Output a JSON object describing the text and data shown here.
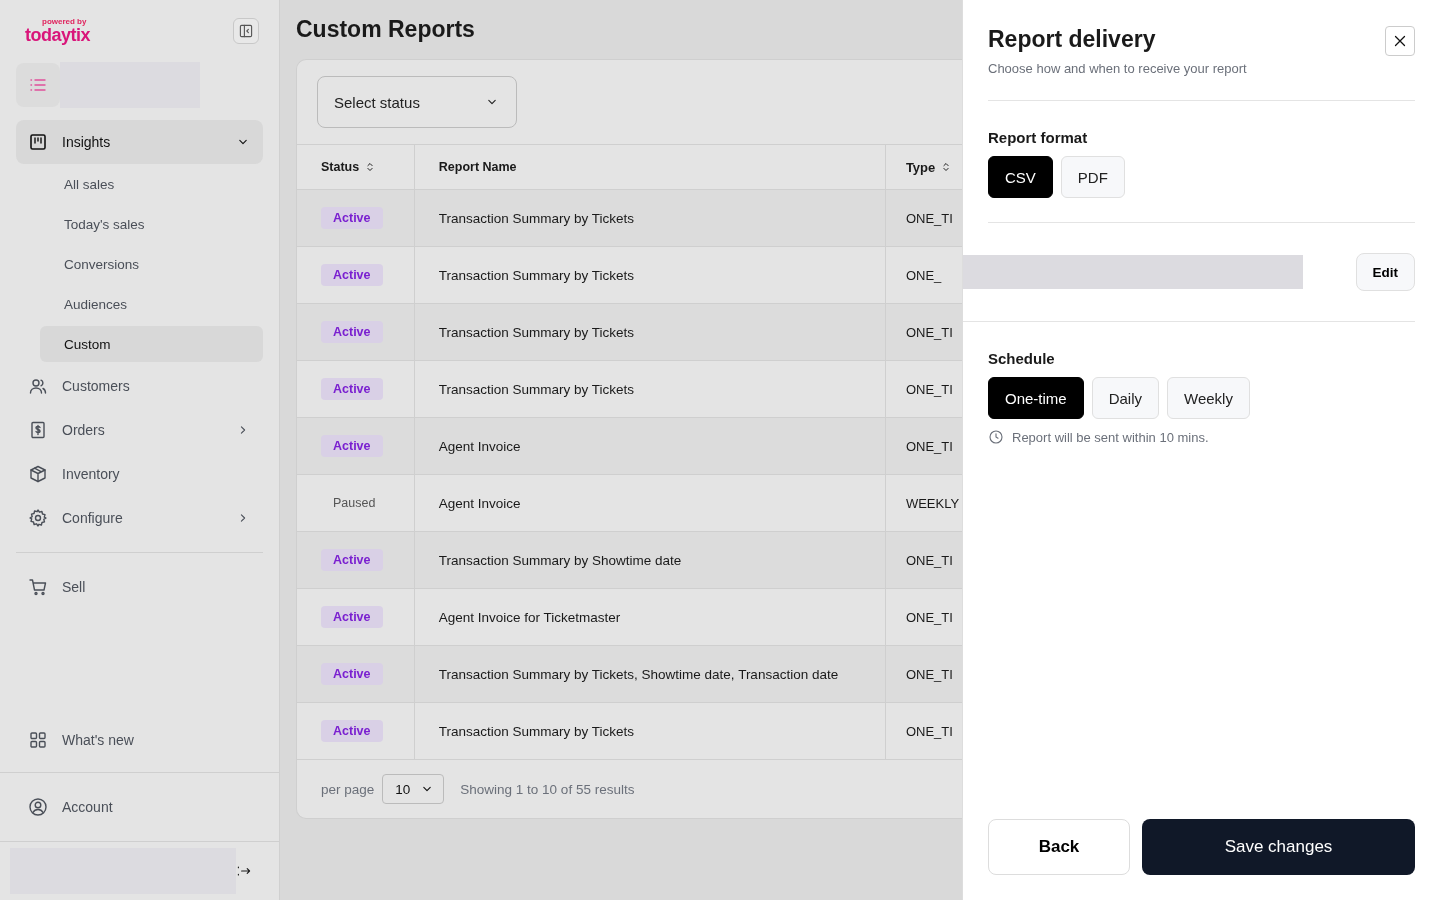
{
  "sidebar": {
    "logo": {
      "top": "powered by",
      "brand": "todaytix"
    },
    "nav": [
      {
        "label": "Insights",
        "selected": true,
        "expanded": true,
        "children": [
          {
            "label": "All sales",
            "selected": false
          },
          {
            "label": "Today's sales",
            "selected": false
          },
          {
            "label": "Conversions",
            "selected": false
          },
          {
            "label": "Audiences",
            "selected": false
          },
          {
            "label": "Custom",
            "selected": true
          }
        ]
      },
      {
        "label": "Customers",
        "selected": false
      },
      {
        "label": "Orders",
        "selected": false,
        "expanded": false
      },
      {
        "label": "Inventory",
        "selected": false
      },
      {
        "label": "Configure",
        "selected": false,
        "expanded": false
      }
    ],
    "sell": {
      "label": "Sell"
    },
    "whats_new": {
      "label": "What's new"
    },
    "account": {
      "label": "Account"
    }
  },
  "page": {
    "title": "Custom Reports",
    "filter": {
      "placeholder": "Select status"
    },
    "table": {
      "columns": [
        "Status",
        "Report Name",
        "Type"
      ],
      "rows": [
        {
          "status": "Active",
          "kind": "active",
          "name": "Transaction Summary by Tickets",
          "type": "ONE_TI"
        },
        {
          "status": "Active",
          "kind": "active",
          "name": "Transaction Summary by Tickets",
          "type": "ONE_"
        },
        {
          "status": "Active",
          "kind": "active",
          "name": "Transaction Summary by Tickets",
          "type": "ONE_TI"
        },
        {
          "status": "Active",
          "kind": "active",
          "name": "Transaction Summary by Tickets",
          "type": "ONE_TI"
        },
        {
          "status": "Active",
          "kind": "active",
          "name": "Agent Invoice",
          "type": "ONE_TI"
        },
        {
          "status": "Paused",
          "kind": "paused",
          "name": "Agent Invoice",
          "type": "WEEKLY"
        },
        {
          "status": "Active",
          "kind": "active",
          "name": "Transaction Summary by Showtime date",
          "type": "ONE_TI"
        },
        {
          "status": "Active",
          "kind": "active",
          "name": "Agent Invoice for Ticketmaster",
          "type": "ONE_TI"
        },
        {
          "status": "Active",
          "kind": "active",
          "name": "Transaction Summary by Tickets, Showtime date, Transaction date",
          "type": "ONE_TI"
        },
        {
          "status": "Active",
          "kind": "active",
          "name": "Transaction Summary by Tickets",
          "type": "ONE_TI"
        }
      ]
    },
    "pagination": {
      "per_page_label": "per page",
      "per_page": "10",
      "summary": "Showing 1 to 10 of 55 results"
    }
  },
  "drawer": {
    "title": "Report delivery",
    "subtitle": "Choose how and when to receive your report",
    "format": {
      "label": "Report format",
      "options": [
        {
          "label": "CSV",
          "selected": true
        },
        {
          "label": "PDF",
          "selected": false
        }
      ]
    },
    "recipients": {
      "edit": "Edit"
    },
    "schedule": {
      "label": "Schedule",
      "options": [
        {
          "label": "One-time",
          "selected": true
        },
        {
          "label": "Daily",
          "selected": false
        },
        {
          "label": "Weekly",
          "selected": false
        }
      ],
      "note": "Report will be sent within 10 mins."
    },
    "back": "Back",
    "save": "Save changes"
  }
}
